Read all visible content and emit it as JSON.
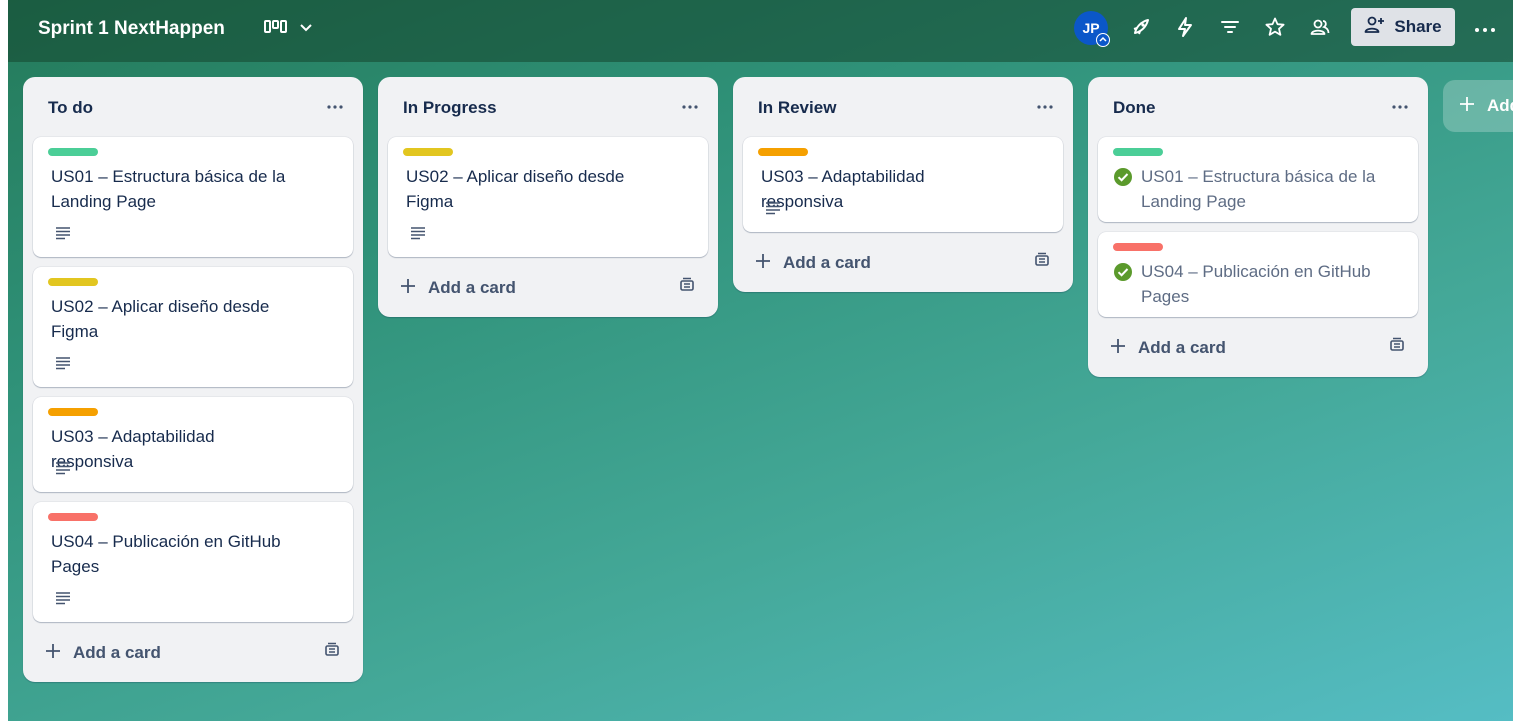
{
  "board": {
    "title": "Sprint 1 NextHappen",
    "background_start": "#247a5a",
    "background_end": "#55bdc4"
  },
  "topbar": {
    "view_icon": "board-view-icon",
    "avatar_initials": "JP",
    "avatar_color": "#0b57c9",
    "icons": [
      "rocket-icon",
      "lightning-icon",
      "filter-icon",
      "star-icon",
      "collaborators-icon"
    ],
    "share_label": "Share",
    "more_icon": "ellipsis-icon"
  },
  "lists": [
    {
      "title": "To do",
      "cards": [
        {
          "title": "US01 – Estructura básica de la Landing Page",
          "label_color": "#4bce97",
          "has_description": true
        },
        {
          "title": "US02 – Aplicar diseño desde Figma",
          "label_color": "#e2c620",
          "has_description": true
        },
        {
          "title": "US03 – Adaptabilidad responsiva",
          "label_color": "#f5a000",
          "has_description": true
        },
        {
          "title": "US04 – Publicación en GitHub Pages",
          "label_color": "#f87168",
          "has_description": true
        }
      ],
      "add_card_label": "Add a card"
    },
    {
      "title": "In Progress",
      "cards": [
        {
          "title": "US02 – Aplicar diseño desde Figma",
          "label_color": "#e2c620",
          "has_description": true
        }
      ],
      "add_card_label": "Add a card"
    },
    {
      "title": "In Review",
      "cards": [
        {
          "title": "US03 – Adaptabilidad responsiva",
          "label_color": "#f5a000",
          "has_description": true
        }
      ],
      "add_card_label": "Add a card"
    },
    {
      "title": "Done",
      "cards": [
        {
          "title": "US01 – Estructura básica de la Landing Page",
          "label_color": "#4bce97",
          "completed": true
        },
        {
          "title": "US04 – Publicación en GitHub Pages",
          "label_color": "#f87168",
          "completed": true
        }
      ],
      "add_card_label": "Add a card"
    }
  ],
  "add_list_label": "Add"
}
